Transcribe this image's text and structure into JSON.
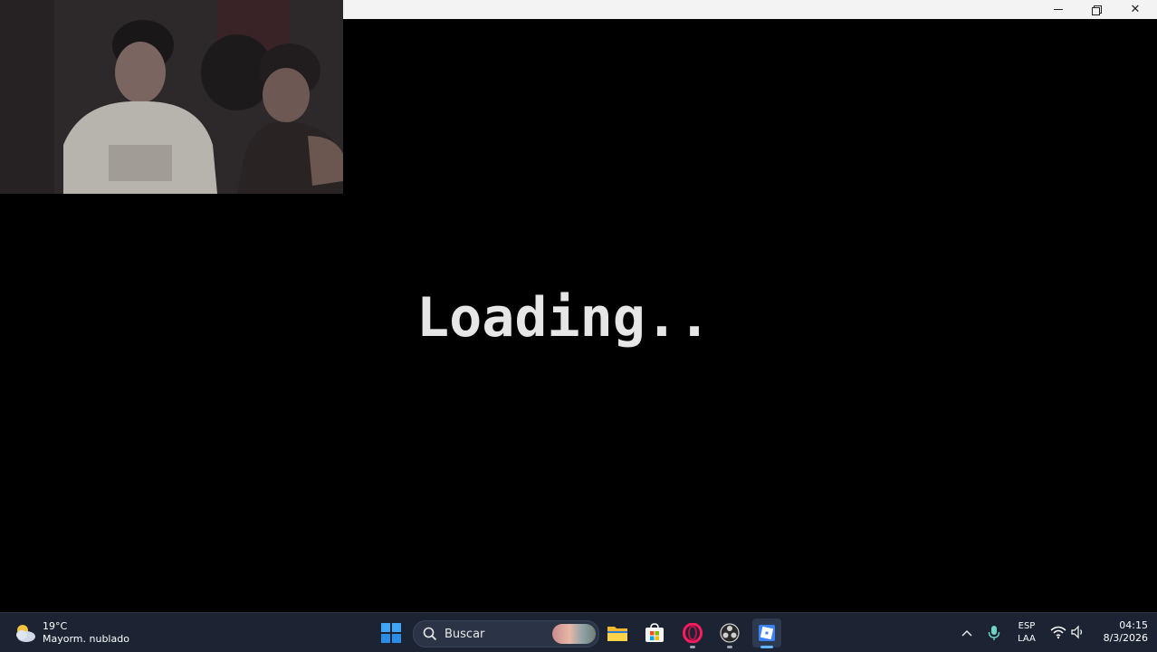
{
  "window": {
    "controls": {
      "minimize_icon": "minimize-icon",
      "restore_icon": "restore-icon",
      "close_icon": "close-icon",
      "close_label": "✕"
    }
  },
  "main": {
    "loading_text": "Loading.."
  },
  "taskbar": {
    "weather": {
      "temperature": "19°C",
      "description": "Mayorm. nublado",
      "icon": "partly-cloudy-icon"
    },
    "search": {
      "label": "Buscar"
    },
    "apps": [
      {
        "name": "start",
        "icon": "windows-logo-icon"
      },
      {
        "name": "file-explorer",
        "icon": "folder-icon"
      },
      {
        "name": "microsoft-store",
        "icon": "store-icon"
      },
      {
        "name": "opera",
        "icon": "opera-icon"
      },
      {
        "name": "obs",
        "icon": "obs-icon"
      },
      {
        "name": "roblox",
        "icon": "roblox-icon",
        "active": true
      }
    ],
    "tray": {
      "language_top": "ESP",
      "language_bottom": "LAA",
      "time": "04:15",
      "date": "8/3/2026"
    }
  },
  "colors": {
    "taskbar_bg": "#1c2433",
    "titlebar_bg": "#f3f3f3",
    "loading_text": "#e6e6e6",
    "accent_blue": "#0078d4"
  }
}
